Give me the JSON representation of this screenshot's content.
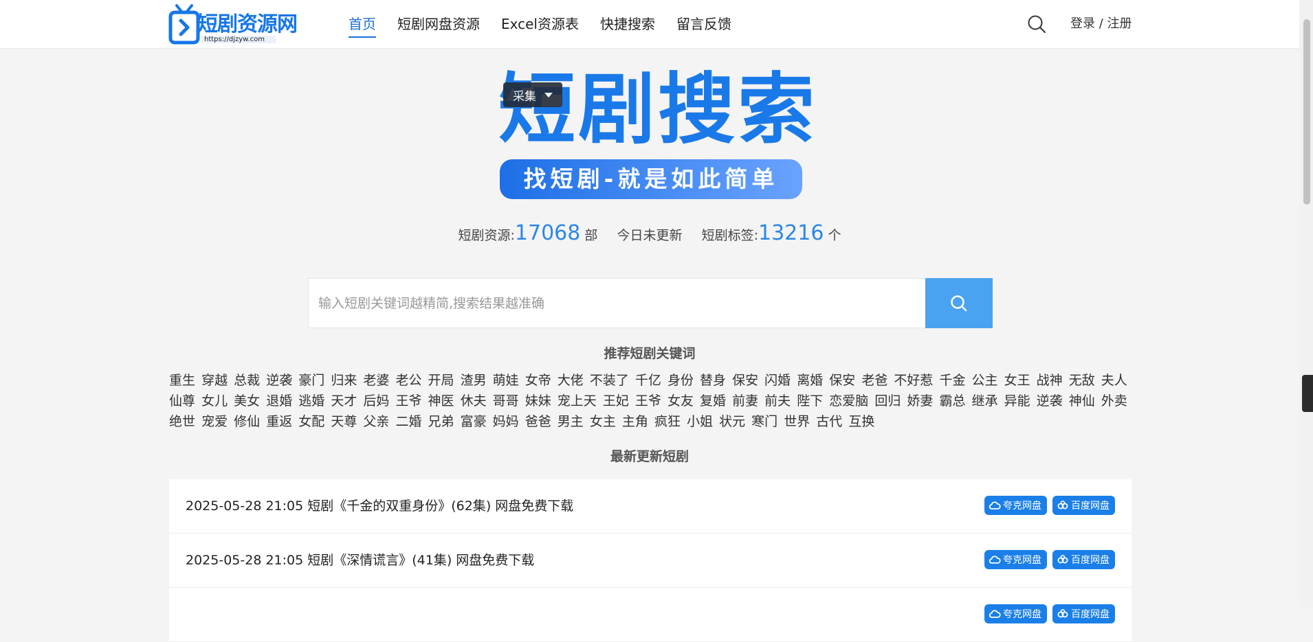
{
  "header": {
    "logo_text": "短剧资源网",
    "logo_url": "https://djzyw.com",
    "nav": [
      {
        "label": "首页",
        "active": true
      },
      {
        "label": "短剧网盘资源",
        "active": false
      },
      {
        "label": "Excel资源表",
        "active": false
      },
      {
        "label": "快捷搜索",
        "active": false
      },
      {
        "label": "留言反馈",
        "active": false
      }
    ],
    "login_label": "登录 / 注册"
  },
  "hero": {
    "title": "短剧搜索",
    "collect_label": "采集",
    "slogan": "找短剧-就是如此简单"
  },
  "stats": {
    "resources_label": "短剧资源:",
    "resources_count": "17068",
    "resources_unit": "部",
    "update_text": "今日未更新",
    "tags_label": "短剧标签:",
    "tags_count": "13216",
    "tags_unit": "个"
  },
  "search": {
    "placeholder": "输入短剧关键词越精简,搜索结果越准确"
  },
  "keywords_title": "推荐短剧关键词",
  "keywords": [
    "重生",
    "穿越",
    "总裁",
    "逆袭",
    "豪门",
    "归来",
    "老婆",
    "老公",
    "开局",
    "渣男",
    "萌娃",
    "女帝",
    "大佬",
    "不装了",
    "千亿",
    "身份",
    "替身",
    "保安",
    "闪婚",
    "离婚",
    "保安",
    "老爸",
    "不好惹",
    "千金",
    "公主",
    "女王",
    "战神",
    "无敌",
    "夫人",
    "仙尊",
    "女儿",
    "美女",
    "退婚",
    "逃婚",
    "天才",
    "后妈",
    "王爷",
    "神医",
    "休夫",
    "哥哥",
    "妹妹",
    "宠上天",
    "王妃",
    "王爷",
    "女友",
    "复婚",
    "前妻",
    "前夫",
    "陛下",
    "恋爱脑",
    "回归",
    "娇妻",
    "霸总",
    "继承",
    "异能",
    "逆袭",
    "神仙",
    "外卖",
    "绝世",
    "宠爱",
    "修仙",
    "重返",
    "女配",
    "天尊",
    "父亲",
    "二婚",
    "兄弟",
    "富豪",
    "妈妈",
    "爸爸",
    "男主",
    "女主",
    "主角",
    "疯狂",
    "小姐",
    "状元",
    "寒门",
    "世界",
    "古代",
    "互换"
  ],
  "latest_title": "最新更新短剧",
  "latest": [
    {
      "text": "2025-05-28 21:05 短剧《千金的双重身份》(62集) 网盘免费下载"
    },
    {
      "text": "2025-05-28 21:05 短剧《深情谎言》(41集) 网盘免费下载"
    },
    {
      "text": ""
    }
  ],
  "badges": {
    "quark": "夸克网盘",
    "baidu": "百度网盘"
  },
  "colors": {
    "brand": "#1a79e8",
    "search_button": "#4aa3f0",
    "badge": "#1a7fe8"
  }
}
